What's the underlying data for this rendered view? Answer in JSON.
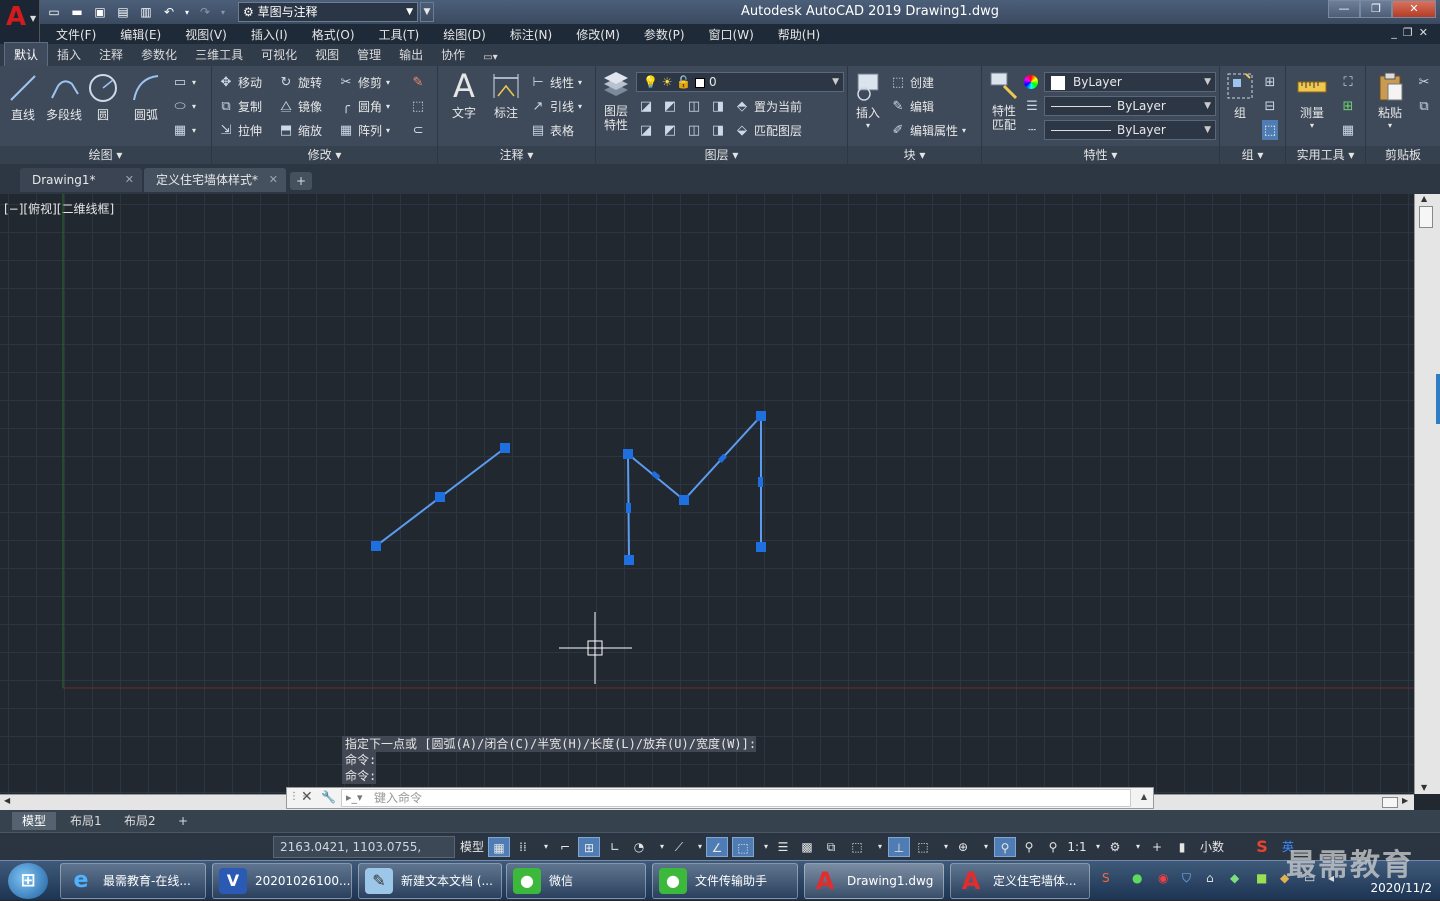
{
  "titlebar": {
    "app_title": "Autodesk AutoCAD 2019    Drawing1.dwg",
    "workspace": "草图与注释"
  },
  "menu": [
    "文件(F)",
    "编辑(E)",
    "视图(V)",
    "插入(I)",
    "格式(O)",
    "工具(T)",
    "绘图(D)",
    "标注(N)",
    "修改(M)",
    "参数(P)",
    "窗口(W)",
    "帮助(H)"
  ],
  "ribbon_tabs": [
    "默认",
    "插入",
    "注释",
    "参数化",
    "三维工具",
    "可视化",
    "视图",
    "管理",
    "输出",
    "协作"
  ],
  "ribbon": {
    "draw": {
      "title": "绘图",
      "line": "直线",
      "polyline": "多段线",
      "circle": "圆",
      "arc": "圆弧"
    },
    "modify": {
      "title": "修改",
      "move": "移动",
      "rotate": "旋转",
      "trim": "修剪",
      "copy": "复制",
      "mirror": "镜像",
      "fillet": "圆角",
      "stretch": "拉伸",
      "scale": "缩放",
      "array": "阵列"
    },
    "annotation": {
      "title": "注释",
      "text": "文字",
      "dimension": "标注",
      "linear": "线性",
      "leader": "引线",
      "table": "表格"
    },
    "layers": {
      "title": "图层",
      "layer_props_1": "图层",
      "layer_props_2": "特性",
      "current_layer": "0",
      "set_current": "置为当前",
      "match_layer": "匹配图层"
    },
    "block": {
      "title": "块",
      "insert": "插入",
      "create": "创建",
      "edit": "编辑",
      "edit_attr": "编辑属性"
    },
    "properties": {
      "title": "特性",
      "match_1": "特性",
      "match_2": "匹配",
      "color": "ByLayer",
      "linetype": "ByLayer",
      "lineweight": "ByLayer"
    },
    "groups": {
      "title": "组",
      "group": "组"
    },
    "utilities": {
      "title": "实用工具",
      "measure": "测量"
    },
    "clipboard": {
      "title": "剪贴板",
      "paste": "粘贴"
    }
  },
  "doc_tabs": [
    {
      "label": "Drawing1*"
    },
    {
      "label": "定义住宅墙体样式*"
    }
  ],
  "viewport_label": "[−][俯视][二维线框]",
  "command": {
    "history": [
      "指定下一点或 [圆弧(A)/闭合(C)/半宽(H)/长度(L)/放弃(U)/宽度(W)]:",
      "命令:",
      "命令:"
    ],
    "placeholder": "键入命令"
  },
  "layout_tabs": [
    "模型",
    "布局1",
    "布局2"
  ],
  "statusbar": {
    "coords": "2163.0421, 1103.0755, 0.0000",
    "model": "模型",
    "scale": "1:1",
    "units": "小数"
  },
  "taskbar": {
    "items": [
      "最需教育-在线...",
      "20201026100...",
      "新建文本文档 (...",
      "微信",
      "文件传输助手",
      "Drawing1.dwg",
      "定义住宅墙体..."
    ],
    "ime": "英",
    "date": "2020/11/2"
  },
  "watermark": "最需教育",
  "colors": {
    "canvas_bg": "#212830",
    "selection": "#3b82f6",
    "grip": "#1e6fe0",
    "status_on": "#4f7db3"
  }
}
